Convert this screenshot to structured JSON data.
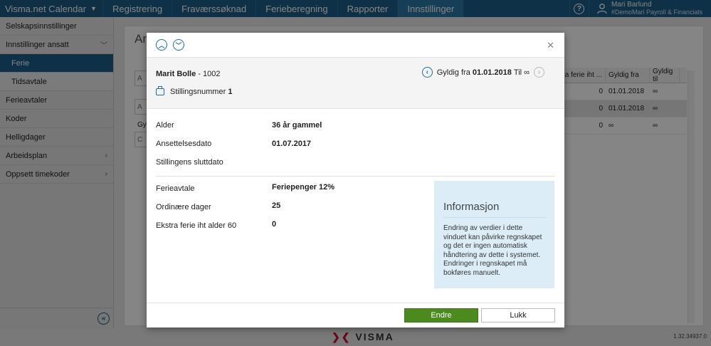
{
  "topbar": {
    "app_name": "Visma.net Calendar",
    "nav": [
      "Registrering",
      "Fraværssøknad",
      "Ferieberegning",
      "Rapporter",
      "Innstillinger"
    ],
    "active_nav": "Innstillinger",
    "help": "?",
    "user_name": "Mari Barlund",
    "user_company": "#DemoMari Payroll & Financials"
  },
  "sidebar": {
    "items": [
      {
        "label": "Selskapsinnstillinger"
      },
      {
        "label": "Innstillinger ansatt"
      },
      {
        "label": "Ferie"
      },
      {
        "label": "Tidsavtale"
      },
      {
        "label": "Ferieavtaler"
      },
      {
        "label": "Koder"
      },
      {
        "label": "Helligdager"
      },
      {
        "label": "Arbeidsplan"
      },
      {
        "label": "Oppsett timekoder"
      }
    ]
  },
  "background": {
    "title": "An",
    "grid_headers": [
      "ra ferie iht ...",
      "Gyldig fra",
      "Gyldig til"
    ],
    "grid_rows": [
      [
        "0",
        "01.01.2018",
        "∞"
      ],
      [
        "0",
        "01.01.2018",
        "∞"
      ],
      [
        "0",
        "∞",
        "∞"
      ]
    ],
    "filter_label": "Gy",
    "box_a1": "A",
    "box_a2": "A",
    "box_c": "C"
  },
  "modal": {
    "employee_name": "Marit Bolle",
    "employee_id": " - 1002",
    "position_label": "Stillingsnummer",
    "position_value": "1",
    "valid_from_label": "Gyldig fra",
    "valid_from": "01.01.2018",
    "valid_to_label": "Til",
    "valid_to": "∞",
    "fields": [
      {
        "label": "Alder",
        "value": "36 år gammel"
      },
      {
        "label": "Ansettelsesdato",
        "value": "01.07.2017"
      },
      {
        "label": "Stillingens sluttdato",
        "value": ""
      }
    ],
    "fields2": [
      {
        "label": "Ferieavtale",
        "value": "Feriepenger 12%"
      },
      {
        "label": "Ordinære dager",
        "value": "25"
      },
      {
        "label": "Ekstra ferie iht alder 60",
        "value": "0"
      }
    ],
    "info_title": "Informasjon",
    "info_text": "Endring av verdier i dette vinduet kan påvirke regnskapet og det er ingen automatisk håndtering av dette i systemet. Endringer i regnskapet må bokføres manuelt.",
    "btn_edit": "Endre",
    "btn_close": "Lukk"
  },
  "footer": {
    "logo": "VISMA",
    "version": "1.32.34937.0"
  }
}
